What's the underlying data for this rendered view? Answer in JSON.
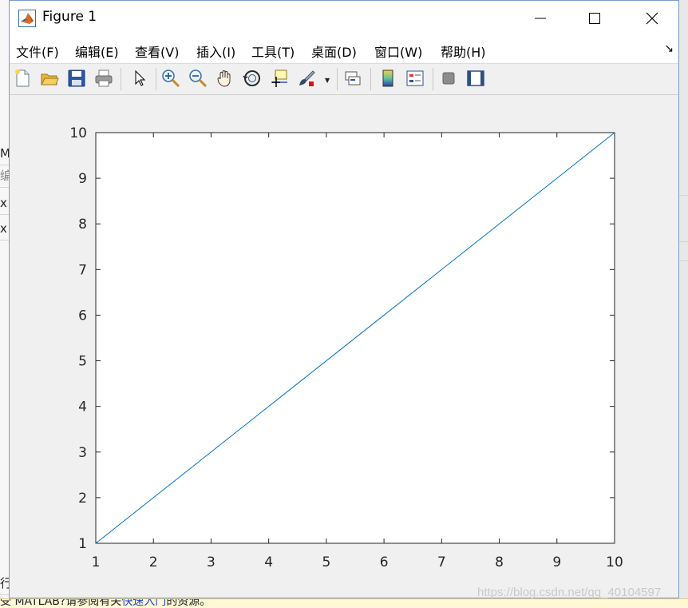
{
  "window": {
    "title": "Figure 1",
    "controls": {
      "minimize": "minimize",
      "maximize": "maximize",
      "close": "close"
    }
  },
  "menu": {
    "items": [
      "文件(F)",
      "编辑(E)",
      "查看(V)",
      "插入(I)",
      "工具(T)",
      "桌面(D)",
      "窗口(W)",
      "帮助(H)"
    ],
    "overflow_icon": "↘"
  },
  "toolbar": {
    "buttons": [
      "new-figure",
      "open-file",
      "save",
      "print",
      "select-arrow",
      "zoom-in",
      "zoom-out",
      "pan",
      "rotate-3d",
      "data-cursor",
      "brush",
      "link-plot",
      "insert-colorbar",
      "insert-legend",
      "hide-plot-tools",
      "show-plot-tools"
    ]
  },
  "chart_data": {
    "type": "line",
    "x": [
      1,
      2,
      3,
      4,
      5,
      6,
      7,
      8,
      9,
      10
    ],
    "series": [
      {
        "values": [
          1,
          2,
          3,
          4,
          5,
          6,
          7,
          8,
          9,
          10
        ],
        "color": "#0072bd"
      }
    ],
    "xlim": [
      1,
      10
    ],
    "ylim": [
      1,
      10
    ],
    "xticks": [
      "1",
      "2",
      "3",
      "4",
      "5",
      "6",
      "7",
      "8",
      "9",
      "10"
    ],
    "yticks": [
      "1",
      "2",
      "3",
      "4",
      "5",
      "6",
      "7",
      "8",
      "9",
      "10"
    ],
    "title": "",
    "xlabel": "",
    "ylabel": "",
    "grid": false
  },
  "background": {
    "left_fragments": [
      "M",
      "编",
      "x",
      "x"
    ],
    "left_bottom_fragment": "行",
    "status_text_before": "受 MATLAB?请参阅有关",
    "status_link": "快速入门",
    "status_text_after": "的资源。"
  },
  "watermark": "https://blog.csdn.net/qq_40104597",
  "colors": {
    "line": "#0072bd",
    "figure_bg": "#f0f0f0",
    "axes_bg": "#ffffff",
    "window_border": "#7a9cc9"
  }
}
